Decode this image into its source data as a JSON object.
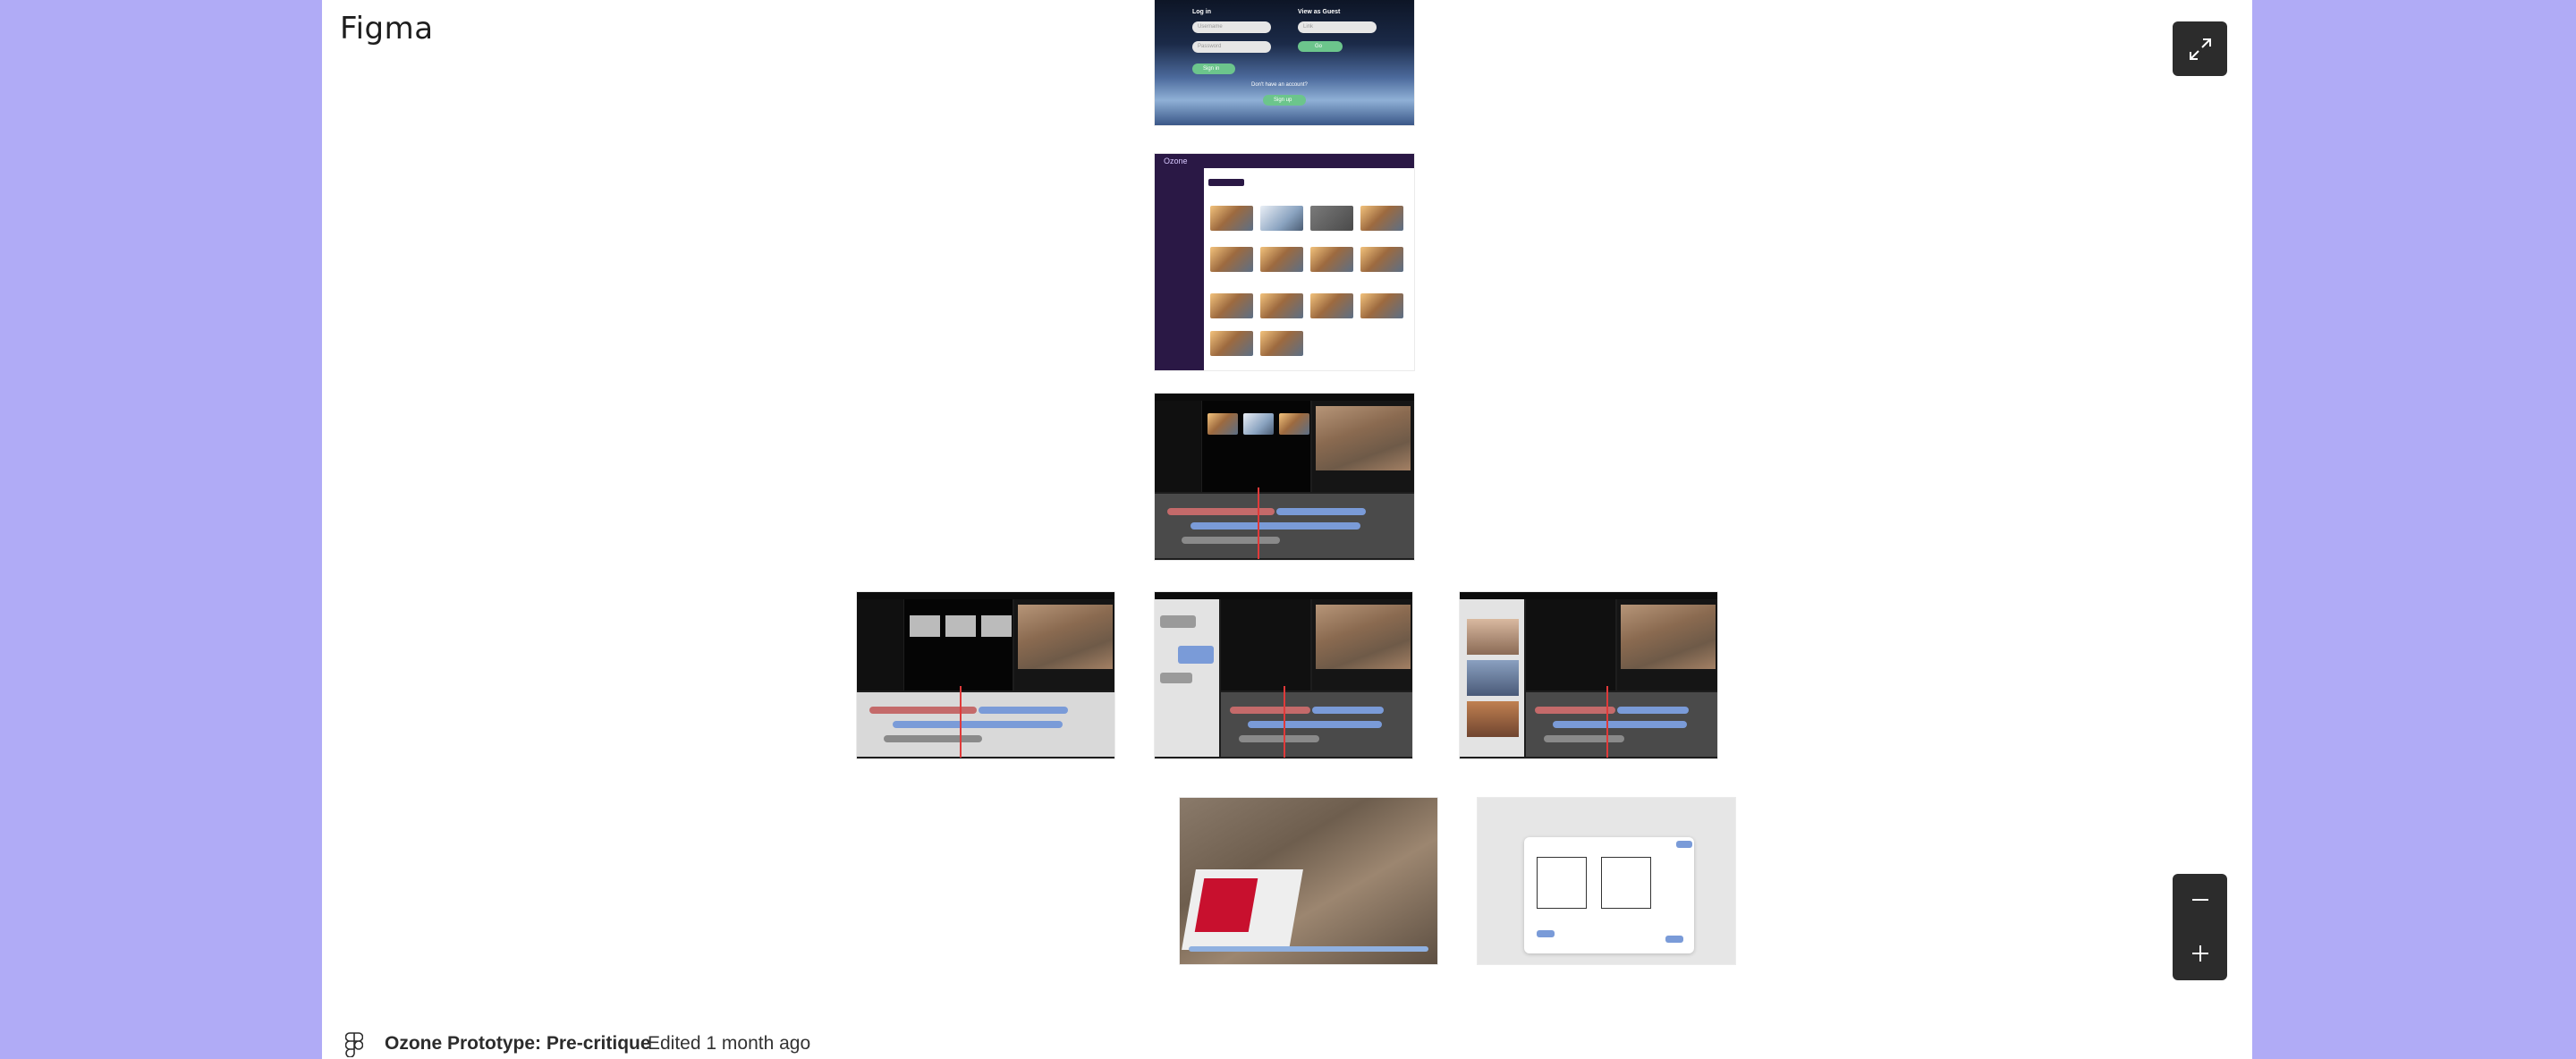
{
  "app": {
    "title": "Figma"
  },
  "file": {
    "name": "Ozone Prototype: Pre-critique",
    "edited": "Edited 1 month ago"
  },
  "controls": {
    "expand_icon": "expand-arrows-icon",
    "zoom_out_icon": "minus-icon",
    "zoom_in_icon": "plus-icon"
  },
  "frames": {
    "login": {
      "log_in": "Log in",
      "username": "Username",
      "password": "Password",
      "sign_in": "Sign in",
      "view_as_guest": "View as Guest",
      "link": "Link",
      "go": "Go",
      "dont_have_account": "Don't have an account?",
      "sign_up": "Sign up"
    },
    "gallery": {
      "brand": "Ozone"
    }
  },
  "colors": {
    "background": "#b0abf6",
    "canvas": "#ffffff",
    "control": "#2c2c2c",
    "accent_green": "#6cc58c",
    "gallery_purple": "#2a1845",
    "timeline_red": "#e03a3a",
    "timeline_blue": "#7a9bd8"
  }
}
